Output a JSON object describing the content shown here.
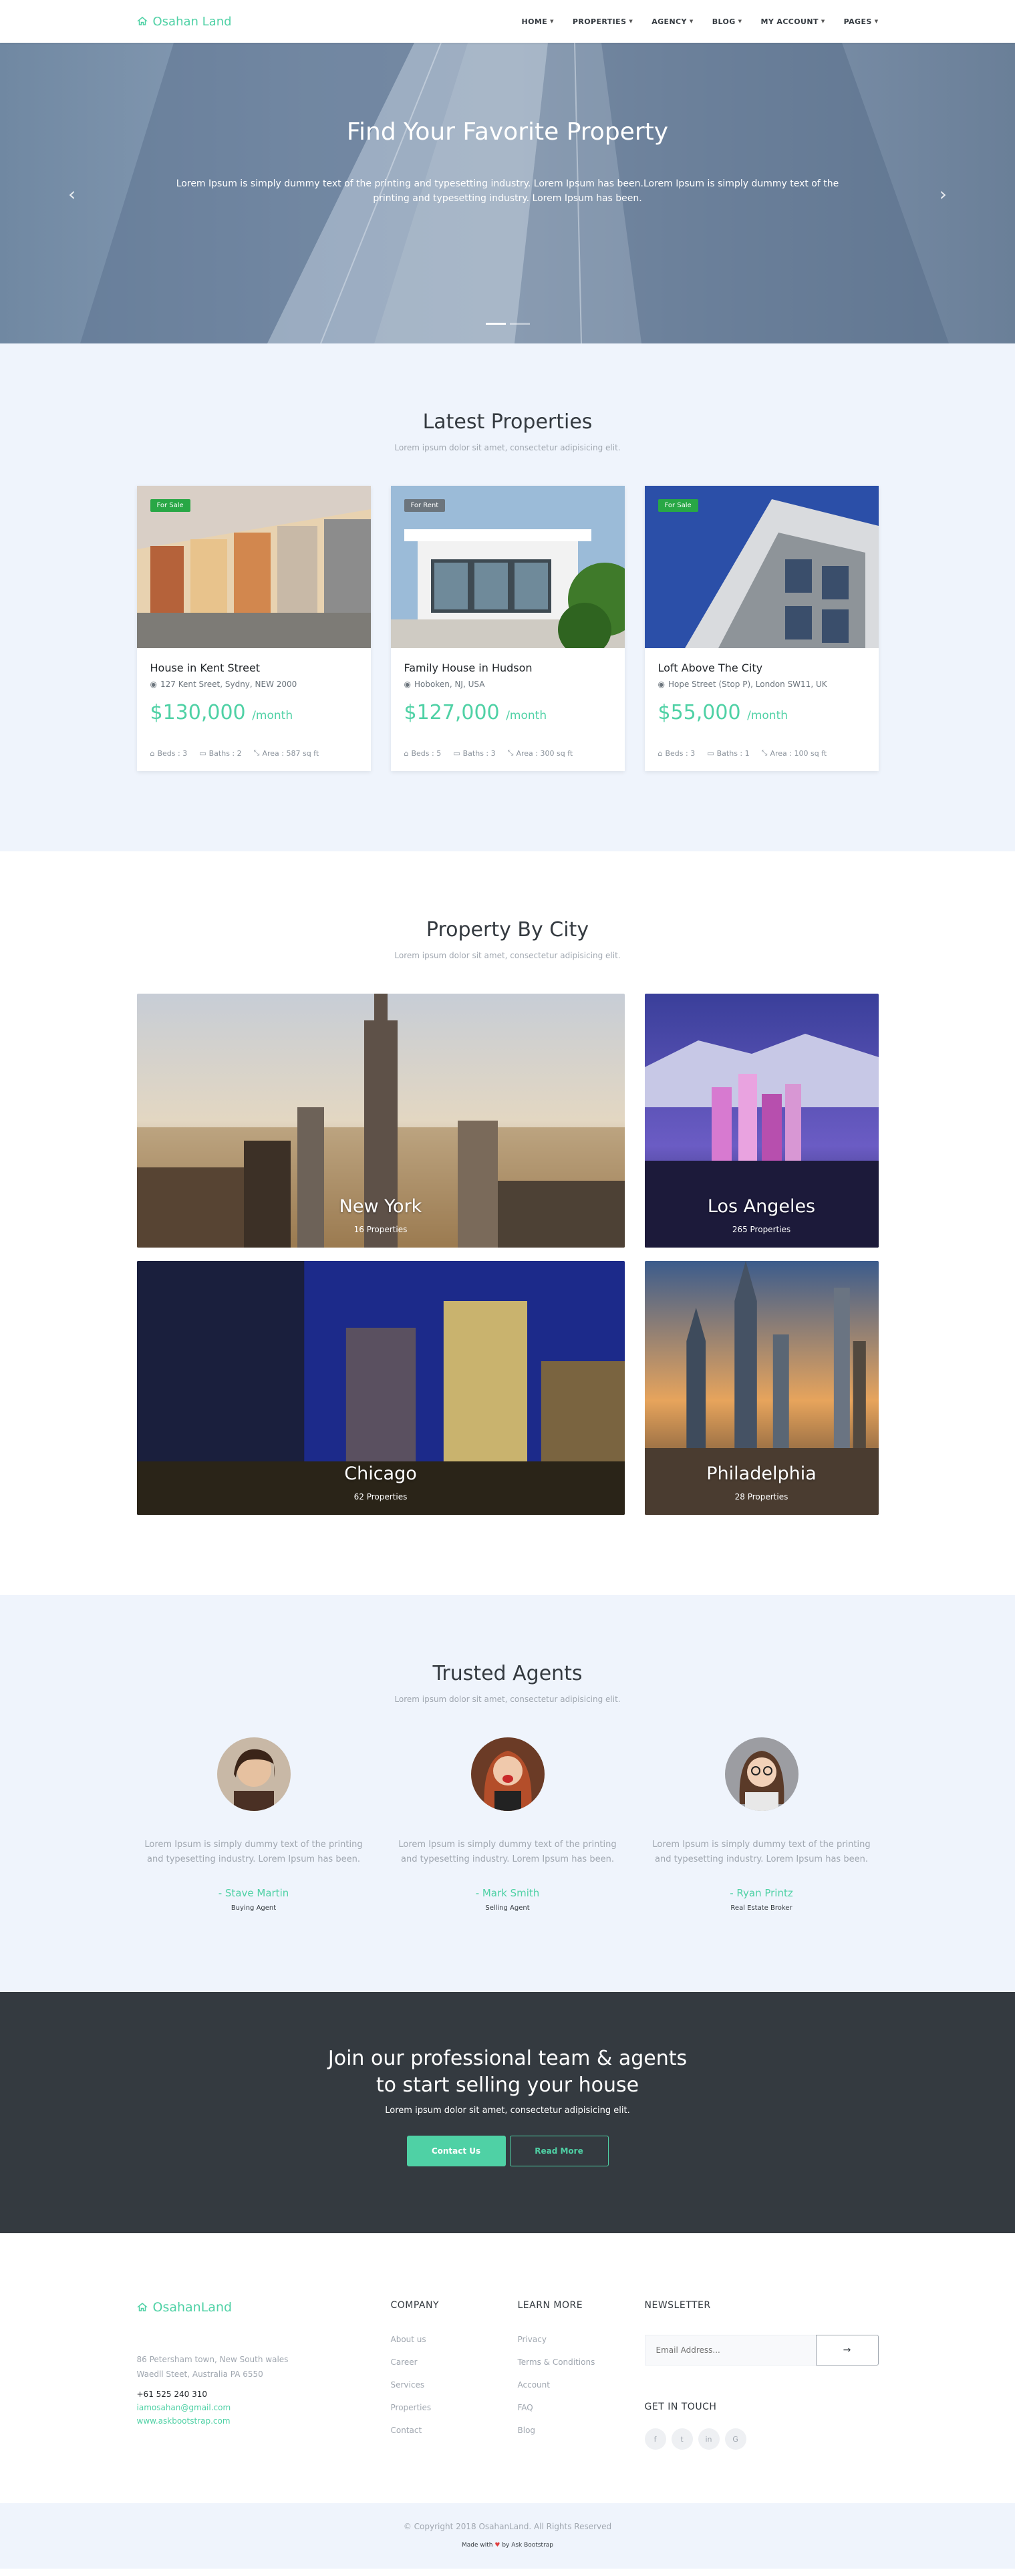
{
  "nav": {
    "brand": "Osahan Land",
    "items": [
      "HOME",
      "PROPERTIES",
      "AGENCY",
      "BLOG",
      "MY ACCOUNT",
      "PAGES"
    ]
  },
  "hero": {
    "title": "Find Your Favorite Property",
    "text": "Lorem Ipsum is simply dummy text of the printing and typesetting industry. Lorem Ipsum has been.Lorem Ipsum is simply dummy text of the printing and typesetting industry. Lorem Ipsum has been."
  },
  "latest": {
    "title": "Latest Properties",
    "subtitle": "Lorem ipsum dolor sit amet, consectetur adipisicing elit.",
    "cards": [
      {
        "badge": "For Sale",
        "title": "House in Kent Street",
        "address": "127 Kent Sreet, Sydny, NEW 2000",
        "price": "$130,000",
        "per": "/month",
        "beds": "Beds : 3",
        "baths": "Baths : 2",
        "area": "Area : 587 sq ft"
      },
      {
        "badge": "For Rent",
        "title": "Family House in Hudson",
        "address": "Hoboken, NJ, USA",
        "price": "$127,000",
        "per": "/month",
        "beds": "Beds : 5",
        "baths": "Baths : 3",
        "area": "Area : 300 sq ft"
      },
      {
        "badge": "For Sale",
        "title": "Loft Above The City",
        "address": "Hope Street (Stop P), London SW11, UK",
        "price": "$55,000",
        "per": "/month",
        "beds": "Beds : 3",
        "baths": "Baths : 1",
        "area": "Area : 100 sq ft"
      }
    ]
  },
  "cities": {
    "title": "Property By City",
    "subtitle": "Lorem ipsum dolor sit amet, consectetur adipisicing elit.",
    "items": [
      {
        "name": "New York",
        "count": "16 Properties"
      },
      {
        "name": "Los Angeles",
        "count": "265 Properties"
      },
      {
        "name": "Chicago",
        "count": "62 Properties"
      },
      {
        "name": "Philadelphia",
        "count": "28 Properties"
      }
    ]
  },
  "agents": {
    "title": "Trusted Agents",
    "subtitle": "Lorem ipsum dolor sit amet, consectetur adipisicing elit.",
    "items": [
      {
        "text": "Lorem Ipsum is simply dummy text of the printing and typesetting industry. Lorem Ipsum has been.",
        "name": "- Stave Martin",
        "role": "Buying Agent"
      },
      {
        "text": "Lorem Ipsum is simply dummy text of the printing and typesetting industry. Lorem Ipsum has been.",
        "name": "- Mark Smith",
        "role": "Selling Agent"
      },
      {
        "text": "Lorem Ipsum is simply dummy text of the printing and typesetting industry. Lorem Ipsum has been.",
        "name": "- Ryan Printz",
        "role": "Real Estate Broker"
      }
    ]
  },
  "cta": {
    "title_line1": "Join our professional team & agents",
    "title_line2": "to start selling your house",
    "subtitle": "Lorem ipsum dolor sit amet, consectetur adipisicing elit.",
    "primary": "Contact Us",
    "secondary": "Read More"
  },
  "footer": {
    "brand": "OsahanLand",
    "address_line1": "86 Petersham town, New South wales",
    "address_line2": "Waedll Steet, Australia PA 6550",
    "phone": "+61 525 240 310",
    "email": "iamosahan@gmail.com",
    "website": "www.askbootstrap.com",
    "company_head": "COMPANY",
    "company": [
      "About us",
      "Career",
      "Services",
      "Properties",
      "Contact"
    ],
    "learn_head": "LEARN MORE",
    "learn": [
      "Privacy",
      "Terms & Conditions",
      "Account",
      "FAQ",
      "Blog"
    ],
    "newsletter_head": "NEWSLETTER",
    "newsletter_placeholder": "Email Address...",
    "touch_head": "GET IN TOUCH",
    "socials": [
      "f",
      "t",
      "in",
      "G"
    ]
  },
  "bottom": {
    "copyright": "© Copyright 2018 OsahanLand. All Rights Reserved",
    "made_prefix": "Made with",
    "made_suffix": "by Ask Bootstrap"
  },
  "colors": {
    "accent": "#4fd1a5",
    "dark": "#343a40",
    "alt_bg": "#eff4fc",
    "badge_sale": "#28a745",
    "badge_rent": "#6c757d"
  }
}
